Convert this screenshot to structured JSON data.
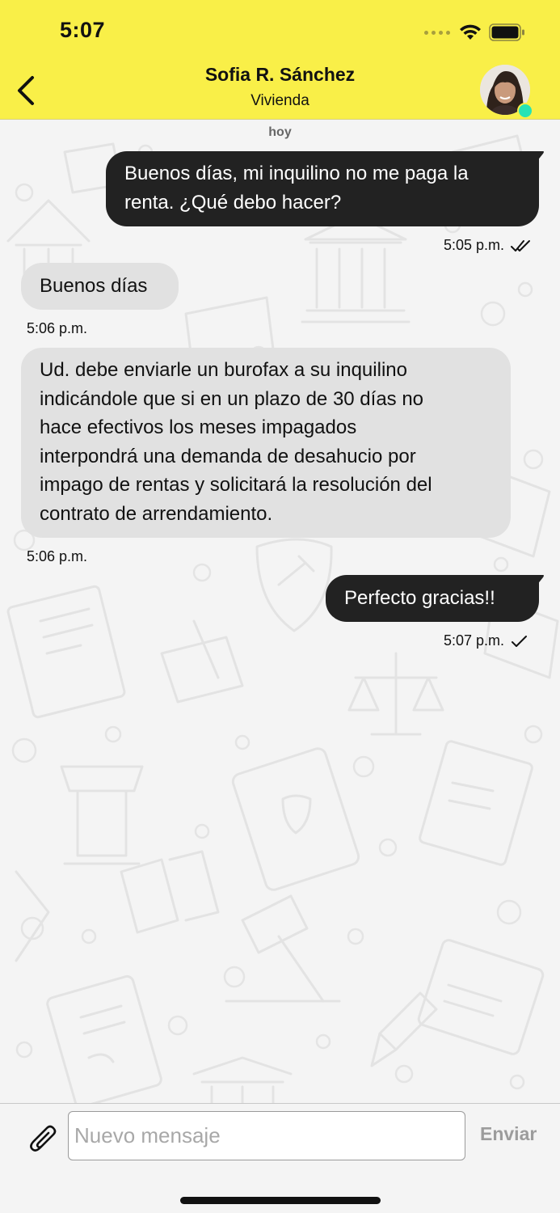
{
  "status_bar": {
    "time": "5:07"
  },
  "header": {
    "contact_name": "Sofia R. Sánchez",
    "subtitle": "Vivienda",
    "accent_color": "#f9ef48",
    "online_color": "#27e3b5"
  },
  "chat": {
    "day_label": "hoy",
    "messages": [
      {
        "direction": "out",
        "lines": [
          "Buenos días, mi inquilino no me paga la",
          "renta. ¿Qué debo hacer?"
        ],
        "time": "5:05 p.m.",
        "status_icon": "double-check-icon"
      },
      {
        "direction": "in",
        "lines": [
          "Buenos días"
        ],
        "time": "5:06 p.m."
      },
      {
        "direction": "in",
        "lines": [
          "Ud. debe enviarle un burofax a su inquilino",
          "indicándole que si en un plazo de 30 días no",
          "hace efectivos los meses impagados",
          "interpondrá una demanda de desahucio por",
          "impago de rentas y solicitará la resolución del",
          "contrato de arrendamiento."
        ],
        "time": "5:06 p.m."
      },
      {
        "direction": "out",
        "lines": [
          "Perfecto gracias!!"
        ],
        "time": "5:07 p.m.",
        "status_icon": "single-check-icon"
      }
    ]
  },
  "composer": {
    "placeholder": "Nuevo mensaje",
    "value": "",
    "send_label": "Enviar"
  }
}
